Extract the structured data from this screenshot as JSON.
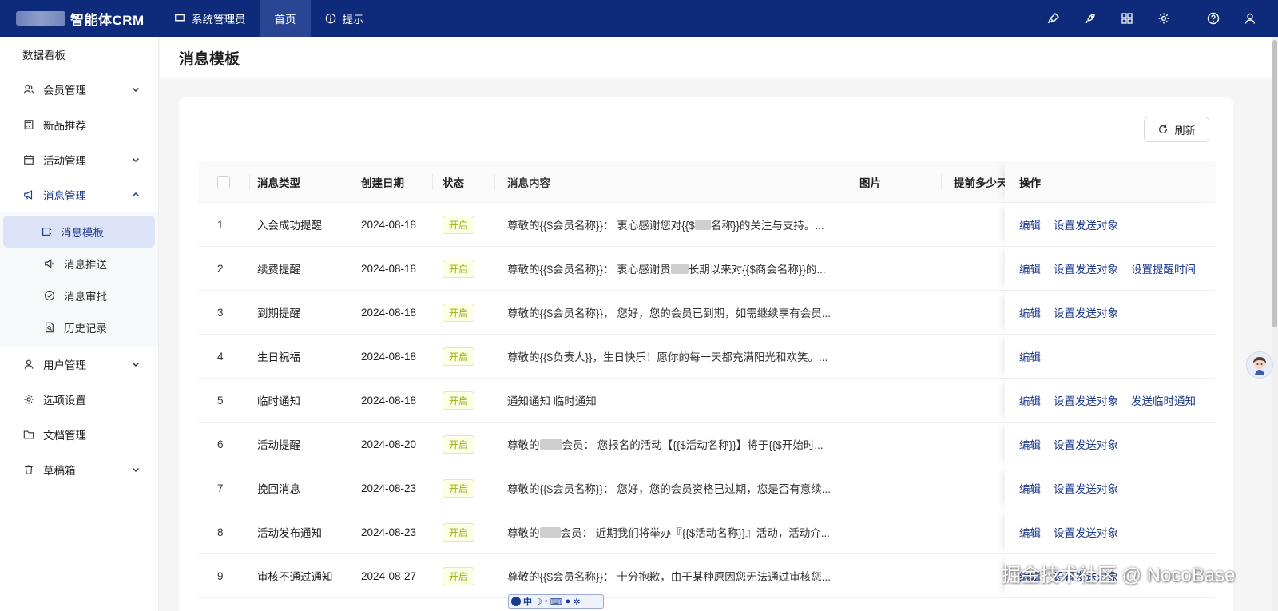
{
  "topbar": {
    "brand": "智能体CRM",
    "nav": [
      {
        "label": "系统管理员",
        "icon": "laptop-icon"
      },
      {
        "label": "首页",
        "icon": ""
      },
      {
        "label": "提示",
        "icon": "info-icon"
      }
    ],
    "right_icons": [
      "brush-icon",
      "rocket-icon",
      "grid-icon",
      "gear-icon",
      "help-icon",
      "user-icon"
    ],
    "bg_color": "#0e2a7a"
  },
  "sidebar": {
    "items": [
      {
        "label": "数据看板",
        "icon": "",
        "expandable": false
      },
      {
        "label": "会员管理",
        "icon": "members-icon",
        "expandable": true
      },
      {
        "label": "新品推荐",
        "icon": "calculator-icon",
        "expandable": false
      },
      {
        "label": "活动管理",
        "icon": "calendar-icon",
        "expandable": true
      },
      {
        "label": "消息管理",
        "icon": "megaphone-icon",
        "expandable": true,
        "open": true
      }
    ],
    "submenu": [
      {
        "label": "消息模板",
        "icon": "template-icon",
        "active": true
      },
      {
        "label": "消息推送",
        "icon": "speaker-icon"
      },
      {
        "label": "消息审批",
        "icon": "check-circle-icon"
      },
      {
        "label": "历史记录",
        "icon": "file-search-icon"
      }
    ],
    "items_after": [
      {
        "label": "用户管理",
        "icon": "user-icon",
        "expandable": true
      },
      {
        "label": "选项设置",
        "icon": "gear-icon",
        "expandable": false
      },
      {
        "label": "文档管理",
        "icon": "folder-icon",
        "expandable": false
      },
      {
        "label": "草稿箱",
        "icon": "trash-icon",
        "expandable": true
      }
    ]
  },
  "page": {
    "title": "消息模板",
    "refresh_label": "刷新"
  },
  "table": {
    "columns": [
      "消息类型",
      "创建日期",
      "状态",
      "消息内容",
      "图片",
      "提前多少天",
      "操作"
    ],
    "rows": [
      {
        "no": "1",
        "type": "入会成功提醒",
        "date": "2024-08-18",
        "status": "开启",
        "content_a": "尊敬的{{$会员名称}}： 衷心感谢您对{{$",
        "mask": 20,
        "content_b": "名称}}的关注与支持。...",
        "ops": [
          "编辑",
          "设置发送对象"
        ]
      },
      {
        "no": "2",
        "type": "续费提醒",
        "date": "2024-08-18",
        "status": "开启",
        "content_a": "尊敬的{{$会员名称}}： 衷心感谢贵",
        "mask": 22,
        "content_b": "长期以来对{{$商会名称}}的...",
        "ops": [
          "编辑",
          "设置发送对象",
          "设置提醒时间"
        ]
      },
      {
        "no": "3",
        "type": "到期提醒",
        "date": "2024-08-18",
        "status": "开启",
        "content_a": "尊敬的{{$会员名称}}， 您好，您的会员已到期，如需继续享有会员...",
        "mask": 0,
        "content_b": "",
        "ops": [
          "编辑",
          "设置发送对象"
        ]
      },
      {
        "no": "4",
        "type": "生日祝福",
        "date": "2024-08-18",
        "status": "开启",
        "content_a": "尊敬的{{$负责人}}，生日快乐！愿你的每一天都充满阳光和欢笑。...",
        "mask": 0,
        "content_b": "",
        "ops": [
          "编辑"
        ]
      },
      {
        "no": "5",
        "type": "临时通知",
        "date": "2024-08-18",
        "status": "开启",
        "content_a": "通知通知 临时通知",
        "mask": 0,
        "content_b": "",
        "ops": [
          "编辑",
          "设置发送对象",
          "发送临时通知"
        ]
      },
      {
        "no": "6",
        "type": "活动提醒",
        "date": "2024-08-20",
        "status": "开启",
        "content_a": "尊敬的",
        "mask": 28,
        "content_b": "会员： 您报名的活动【{{$活动名称}}】将于{{$开始时...",
        "ops": [
          "编辑",
          "设置发送对象"
        ]
      },
      {
        "no": "7",
        "type": "挽回消息",
        "date": "2024-08-23",
        "status": "开启",
        "content_a": "尊敬的{{$会员名称}}： 您好，您的会员资格已过期，您是否有意续...",
        "mask": 0,
        "content_b": "",
        "ops": [
          "编辑",
          "设置发送对象"
        ]
      },
      {
        "no": "8",
        "type": "活动发布通知",
        "date": "2024-08-23",
        "status": "开启",
        "content_a": "尊敬的",
        "mask": 26,
        "content_b": "会员： 近期我们将举办『{{$活动名称}}』活动，活动介...",
        "ops": [
          "编辑",
          "设置发送对象"
        ]
      },
      {
        "no": "9",
        "type": "审核不通过通知",
        "date": "2024-08-27",
        "status": "开启",
        "content_a": "尊敬的{{$会员名称}}： 十分抱歉，由于某种原因您无法通过审核您...",
        "mask": 0,
        "content_b": "",
        "ops": [
          "编辑",
          "设置发送对象"
        ]
      }
    ]
  },
  "watermark": "掘金技术社区 @ NocoBase",
  "ime": {
    "label": "中"
  }
}
